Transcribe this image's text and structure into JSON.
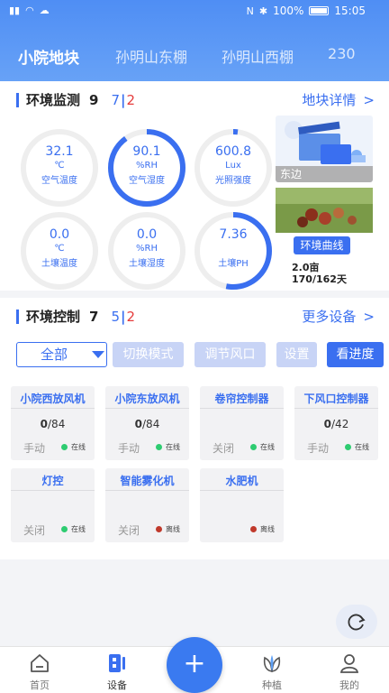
{
  "statusbar": {
    "battery": "100%",
    "time": "15:05"
  },
  "tabs": [
    "小院地块",
    "孙明山东棚",
    "孙明山西棚",
    "230"
  ],
  "env_monitor": {
    "title": "环境监测",
    "total": "9",
    "online": "7",
    "offline": "2",
    "link": "地块详情",
    "gauges": [
      {
        "value": "32.1",
        "unit": "℃",
        "label": "空气温度",
        "fraction": 0.0
      },
      {
        "value": "90.1",
        "unit": "%RH",
        "label": "空气湿度",
        "fraction": 0.9
      },
      {
        "value": "600.8",
        "unit": "Lux",
        "label": "光照强度",
        "fraction": 0.02
      },
      {
        "value": "0.0",
        "unit": "℃",
        "label": "土壤温度",
        "fraction": 0.0
      },
      {
        "value": "0.0",
        "unit": "%RH",
        "label": "土壤湿度",
        "fraction": 0.0
      },
      {
        "value": "7.36",
        "unit": "",
        "label": "土壤PH",
        "fraction": 0.53
      }
    ],
    "plot_caption": "东边",
    "curve_button": "环境曲线",
    "area": "2.0亩",
    "count": "170/162天"
  },
  "env_control": {
    "title": "环境控制",
    "total": "7",
    "online": "5",
    "offline": "2",
    "link": "更多设备",
    "filter": "全部",
    "buttons": [
      "切换模式",
      "调节风口",
      "设置",
      "看进度"
    ],
    "devices": [
      {
        "name": "小院西放风机",
        "current": "0",
        "total": "/84",
        "mode": "手动",
        "status": "在线",
        "status_color": "#2ecc71"
      },
      {
        "name": "小院东放风机",
        "current": "0",
        "total": "/84",
        "mode": "手动",
        "status": "在线",
        "status_color": "#2ecc71"
      },
      {
        "name": "卷帘控制器",
        "current": "",
        "total": "",
        "mode": "关闭",
        "status": "在线",
        "status_color": "#2ecc71"
      },
      {
        "name": "下风口控制器",
        "current": "0",
        "total": "/42",
        "mode": "手动",
        "status": "在线",
        "status_color": "#2ecc71"
      },
      {
        "name": "灯控",
        "current": "",
        "total": "",
        "mode": "关闭",
        "status": "在线",
        "status_color": "#2ecc71"
      },
      {
        "name": "智能雾化机",
        "current": "",
        "total": "",
        "mode": "关闭",
        "status": "离线",
        "status_color": "#c0392b"
      },
      {
        "name": "水肥机",
        "current": "",
        "total": "",
        "mode": "",
        "status": "离线",
        "status_color": "#c0392b"
      }
    ]
  },
  "nav": [
    "首页",
    "设备",
    "种植",
    "我的"
  ],
  "colors": {
    "accent": "#3a6ff0",
    "offline": "#e53b3b"
  }
}
